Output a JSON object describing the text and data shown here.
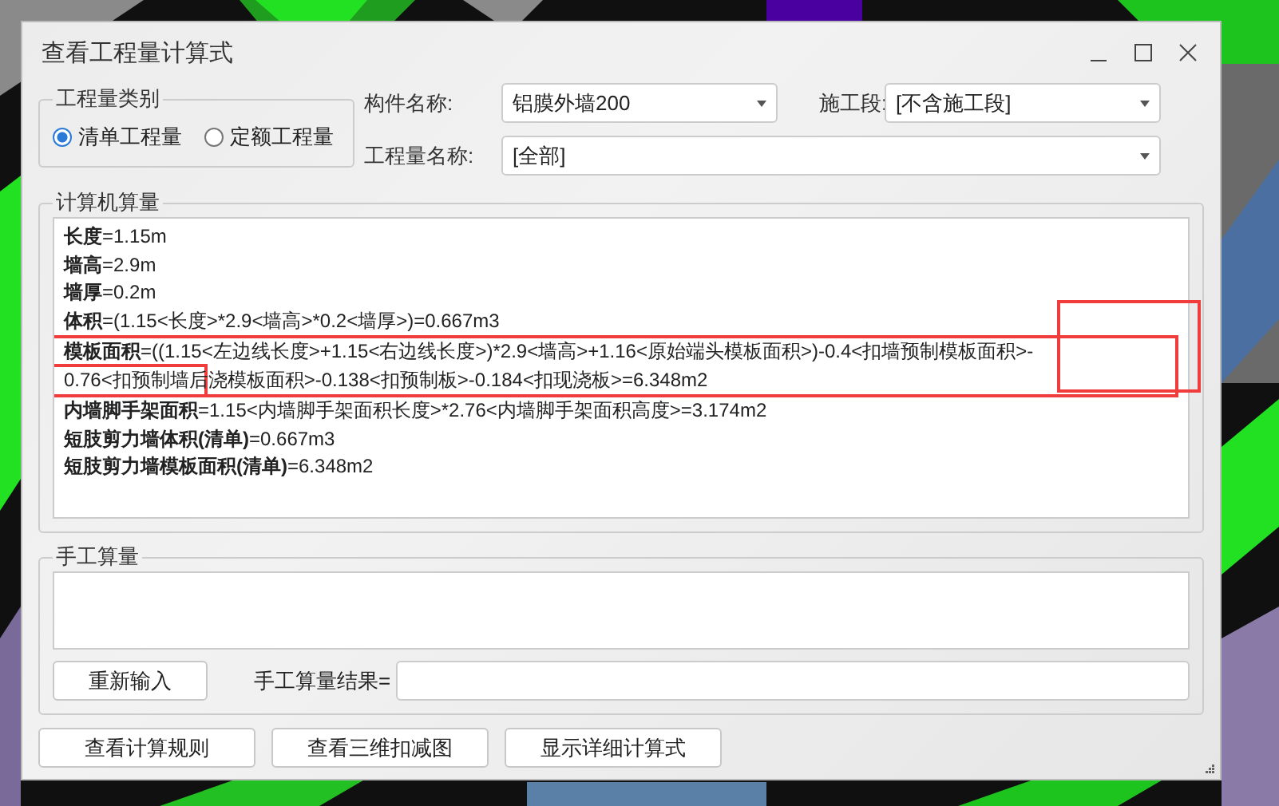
{
  "window": {
    "title": "查看工程量计算式"
  },
  "quantity_type": {
    "legend": "工程量类别",
    "options": [
      {
        "label": "清单工程量",
        "selected": true
      },
      {
        "label": "定额工程量",
        "selected": false
      }
    ]
  },
  "fields": [
    {
      "label": "构件名称:",
      "value": "铝膜外墙200"
    },
    {
      "label": "施工段:",
      "value": "[不含施工段]"
    },
    {
      "label": "工程量名称:",
      "value": "[全部]"
    }
  ],
  "computer_calc": {
    "legend": "计算机算量",
    "lines": [
      {
        "name": "长度",
        "formula": "=1.15m"
      },
      {
        "name": "墙高",
        "formula": "=2.9m"
      },
      {
        "name": "墙厚",
        "formula": "=0.2m"
      },
      {
        "name": "体积",
        "formula": "=(1.15<长度>*2.9<墙高>*0.2<墙厚>)=0.667m3"
      },
      {
        "name": "模板面积",
        "formula": "=((1.15<左边线长度>+1.15<右边线长度>)*2.9<墙高>+1.16<原始端头模板面积>)-0.4<扣墙预制模板面积>-0.76<扣预制墙后浇模板面积>-0.138<扣预制板>-0.184<扣现浇板>=6.348m2"
      },
      {
        "name": "内墙脚手架面积",
        "formula": "=1.15<内墙脚手架面积长度>*2.76<内墙脚手架面积高度>=3.174m2"
      },
      {
        "name": "短肢剪力墙体积(清单)",
        "formula": "=0.667m3"
      },
      {
        "name": "短肢剪力墙模板面积(清单)",
        "formula": "=6.348m2"
      }
    ]
  },
  "manual_calc": {
    "legend": "手工算量",
    "reset_button": "重新输入",
    "result_label": "手工算量结果="
  },
  "buttons": [
    "查看计算规则",
    "查看三维扣减图",
    "显示详细计算式"
  ]
}
